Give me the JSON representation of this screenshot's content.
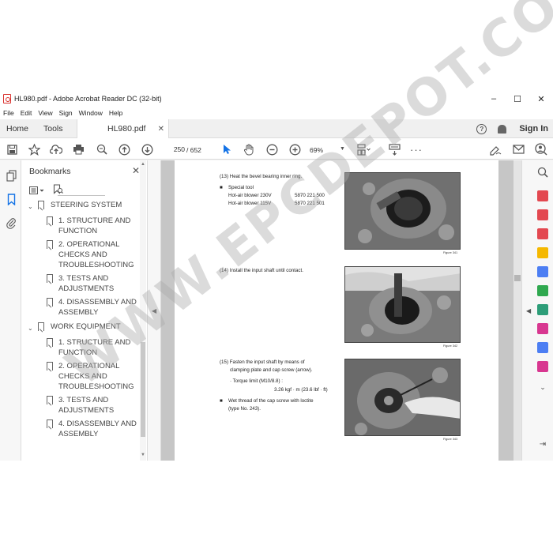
{
  "window": {
    "title": "HL980.pdf - Adobe Acrobat Reader DC (32-bit)",
    "minimize": "–",
    "maximize": "☐",
    "close": "✕"
  },
  "menu": [
    "File",
    "Edit",
    "View",
    "Sign",
    "Window",
    "Help"
  ],
  "tabs": {
    "home": "Home",
    "tools": "Tools",
    "document": "HL980.pdf",
    "sign_in": "Sign In"
  },
  "toolbar": {
    "current_page": "250",
    "total_pages": "/ 652",
    "zoom": "69%"
  },
  "bookmarks": {
    "title": "Bookmarks",
    "items": [
      {
        "label": "STEERING SYSTEM",
        "level": 1
      },
      {
        "label": "1. STRUCTURE AND FUNCTION",
        "level": 2
      },
      {
        "label": "2. OPERATIONAL CHECKS AND TROUBLESHOOTING",
        "level": 2
      },
      {
        "label": "3. TESTS AND ADJUSTMENTS",
        "level": 2
      },
      {
        "label": "4. DISASSEMBLY AND ASSEMBLY",
        "level": 2
      },
      {
        "label": "WORK EQUIPMENT",
        "level": 1
      },
      {
        "label": "1. STRUCTURE AND FUNCTION",
        "level": 2
      },
      {
        "label": "2. OPERATIONAL CHECKS AND TROUBLESHOOTING",
        "level": 2
      },
      {
        "label": "3. TESTS AND ADJUSTMENTS",
        "level": 2
      },
      {
        "label": "4. DISASSEMBLY AND ASSEMBLY",
        "level": 2
      }
    ]
  },
  "document": {
    "step13": "(13) Heat the bevel bearing inner ring.",
    "special_tool": "Special tool",
    "tool1_name": "Hot-air blower 230V",
    "tool1_num": "5870 221 500",
    "tool2_name": "Hot-air blower 115V",
    "tool2_num": "5870 221 501",
    "step14": "(14) Install the input shaft until contact.",
    "step15_a": "(15) Fasten the input shaft by means of",
    "step15_b": "clamping plate and cap screw (arrow).",
    "torque_label": "· Torque limit (M10/8.8) :",
    "torque_value": "3.26 kgf · m (23.6 lbf · ft)",
    "wet_a": "Wet thread of the cap screw with loctite",
    "wet_b": "(type No. 243).",
    "fig1": "Figure 341",
    "fig2": "Figure 342",
    "fig3": "Figure 343"
  },
  "watermark": "WWW.EPCDEPOT.COM"
}
